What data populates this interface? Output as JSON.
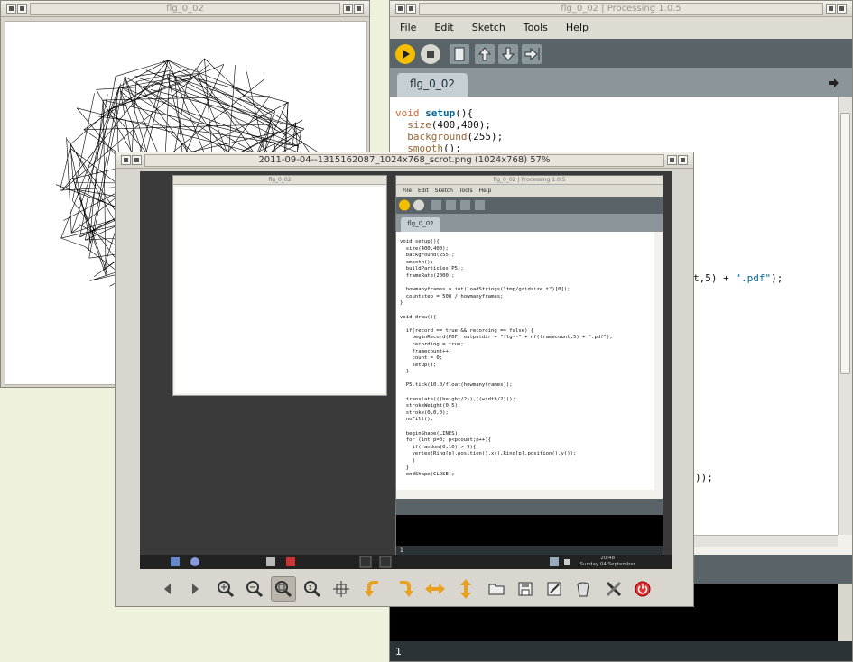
{
  "sketch_window": {
    "title": "flg_0_02"
  },
  "ide": {
    "title": "flg_0_02 | Processing 1.0.5",
    "menu": [
      "File",
      "Edit",
      "Sketch",
      "Tools",
      "Help"
    ],
    "tab": "flg_0_02",
    "code_visible": {
      "l1_a": "void ",
      "l1_b": "setup",
      "l1_c": "(){",
      "l2_a": "  size",
      "l2_b": "(400,400);",
      "l3_a": "  background",
      "l3_b": "(255);",
      "l4_a": "  smooth",
      "l4_b": "();"
    },
    "frag_pdf_a": "t,5) + ",
    "frag_pdf_b": "\".pdf\"",
    "frag_pdf_c": ");",
    "frag_bracket": "));",
    "console_line": "1"
  },
  "viewer": {
    "title": "2011-09-04--1315162087_1024x768_scrot.png (1024x768) 57%",
    "toolbar_icons": [
      "arrow-left-icon",
      "arrow-right-icon",
      "zoom-in-icon",
      "zoom-out-icon",
      "zoom-fit-icon",
      "zoom-actual-icon",
      "fullscreen-icon",
      "rotate-left-icon",
      "rotate-right-icon",
      "flip-horizontal-icon",
      "flip-vertical-icon",
      "open-folder-icon",
      "save-icon",
      "edit-icon",
      "delete-icon",
      "preferences-icon",
      "quit-icon"
    ]
  },
  "mini": {
    "sketch_title": "flg_0_02",
    "ide_title": "flg_0_02 | Processing 1.0.5",
    "menu": [
      "File",
      "Edit",
      "Sketch",
      "Tools",
      "Help"
    ],
    "tab": "flg_0_02",
    "code": "void setup(){\n  size(400,400);\n  background(255);\n  smooth();\n  buildParticles(P5);\n  frameRate(2000);\n\n  howmanyframes = int(loadStrings(\"tmp/gridsize.t\")[0]);\n  countstep = 500 / howmanyframes;\n}\n\nvoid draw(){\n\n  if(record == true && recording == false) {\n    beginRecord(PDF, outputdir + \"flg--\" + nf(framecount,5) + \".pdf\");\n    recording = true;\n    framecount++;\n    count = 0;\n    setup();\n  }\n\n  P5.tick(10.0/float(howmanyframes));\n\n  translate(((height/2)),((width/2)));\n  strokeWeight(0.5);\n  stroke(0,0,0);\n  noFill();\n\n  beginShape(LINES);\n  for (int p=0; p<pcount;p++){\n    if(random(0,10) > 9){\n    vertex(Ring[p].position().x(),Ring[p].position().y());\n    }\n  }\n  endShape(CLOSE);",
    "console_line": "1",
    "clock_time": "20:48",
    "clock_date": "Sunday 04 September"
  }
}
